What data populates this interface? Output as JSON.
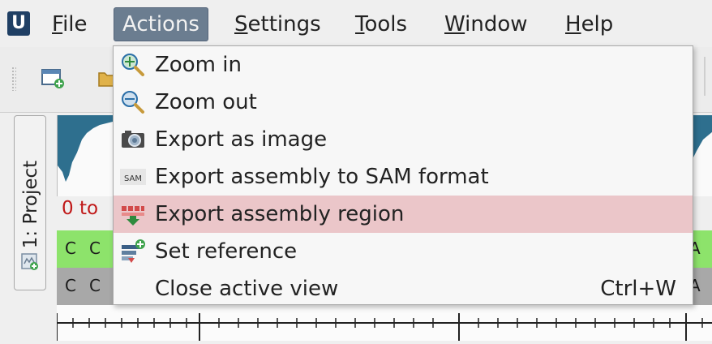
{
  "menubar": {
    "logo": "U",
    "menus": [
      {
        "pre": "",
        "ul": "F",
        "post": "ile"
      },
      {
        "pre": "",
        "ul": "",
        "post": "Actions"
      },
      {
        "pre": "",
        "ul": "S",
        "post": "ettings"
      },
      {
        "pre": "",
        "ul": "T",
        "post": "ools"
      },
      {
        "pre": "",
        "ul": "W",
        "post": "indow"
      },
      {
        "pre": "",
        "ul": "H",
        "post": "elp"
      }
    ]
  },
  "dock": {
    "tab_label": "1: Project"
  },
  "view": {
    "range_label": "0 to",
    "seq_bases": [
      "C",
      "C"
    ],
    "ref_bases": [
      "C",
      "C"
    ],
    "right_seq_base": "A",
    "right_ref_base": "A"
  },
  "actions_menu": {
    "items": [
      {
        "label": "Zoom in",
        "icon": "zoom-in-icon",
        "shortcut": ""
      },
      {
        "label": "Zoom out",
        "icon": "zoom-out-icon",
        "shortcut": ""
      },
      {
        "label": "Export as image",
        "icon": "camera-icon",
        "shortcut": ""
      },
      {
        "label": "Export assembly to SAM format",
        "icon": "sam-icon",
        "shortcut": "",
        "icon_text": "SAM"
      },
      {
        "label": "Export assembly region",
        "icon": "export-region-icon",
        "shortcut": ""
      },
      {
        "label": "Set reference",
        "icon": "set-reference-icon",
        "shortcut": ""
      },
      {
        "label": "Close active view",
        "icon": "",
        "shortcut": "Ctrl+W"
      }
    ],
    "highlighted_index": 4
  },
  "colors": {
    "active_menu_bg": "#6b7d90",
    "highlight": "#ebc6c9",
    "seq_track": "#8de36b",
    "ref_track": "#a8a8a8",
    "coverage": "#2e6f8e",
    "range_text": "#c01818"
  }
}
